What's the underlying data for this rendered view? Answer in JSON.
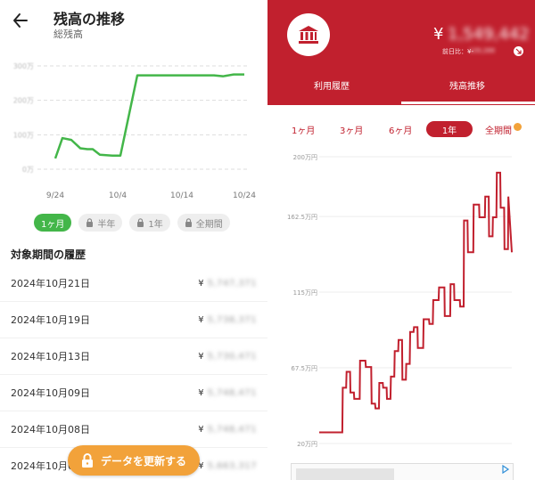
{
  "left": {
    "title": "残高の推移",
    "subtitle": "総残高",
    "chart": {
      "type": "line",
      "y_tick_labels": [
        "300万",
        "200万",
        "100万",
        "0万"
      ],
      "x_tick_labels": [
        "9/24",
        "10/4",
        "10/14",
        "10/24"
      ],
      "line_color": "#43b649",
      "series_dates": [
        "9/22",
        "9/24",
        "9/26",
        "9/28",
        "9/30",
        "10/1",
        "10/2",
        "10/4",
        "10/5",
        "10/6",
        "10/8",
        "10/10",
        "10/14",
        "10/18",
        "10/22",
        "10/24"
      ],
      "values": [
        1.0,
        2.1,
        2.0,
        1.55,
        1.5,
        1.5,
        1.2,
        1.15,
        1.15,
        5.5,
        5.5,
        5.5,
        5.5,
        5.45,
        5.55,
        5.55
      ],
      "value_unit": "relative (y-axis labels obscured)"
    },
    "periods": [
      {
        "label": "1ヶ月",
        "active": true,
        "locked": false
      },
      {
        "label": "半年",
        "active": false,
        "locked": true
      },
      {
        "label": "1年",
        "active": false,
        "locked": true
      },
      {
        "label": "全期間",
        "active": false,
        "locked": true
      }
    ],
    "history_title": "対象期間の履歴",
    "history": [
      {
        "date": "2024年10月21日",
        "currency": "¥",
        "amount": "5,747,371"
      },
      {
        "date": "2024年10月19日",
        "currency": "¥",
        "amount": "5,738,371"
      },
      {
        "date": "2024年10月13日",
        "currency": "¥",
        "amount": "5,730,471"
      },
      {
        "date": "2024年10月09日",
        "currency": "¥",
        "amount": "5,748,471"
      },
      {
        "date": "2024年10月08日",
        "currency": "¥",
        "amount": "5,748,471"
      },
      {
        "date": "2024年10月0",
        "currency": "¥",
        "amount": "5,663,317"
      }
    ],
    "fab_label": "データを更新する"
  },
  "right": {
    "balance_currency": "¥",
    "balance_amount": "1,549,442",
    "prev_day_label": "前日比：¥-",
    "prev_day_amount": "109,288",
    "tabs": [
      {
        "label": "利用履歴",
        "active": false
      },
      {
        "label": "残高推移",
        "active": true
      }
    ],
    "periods": [
      {
        "label": "1ヶ月",
        "active": false
      },
      {
        "label": "3ヶ月",
        "active": false
      },
      {
        "label": "6ヶ月",
        "active": false
      },
      {
        "label": "1年",
        "active": true
      },
      {
        "label": "全期間",
        "active": false,
        "premium": true
      }
    ],
    "colors": {
      "brand": "#c1202e",
      "accent": "#f2a23a",
      "green": "#43b649"
    }
  },
  "chart_data": {
    "type": "line",
    "title": "",
    "ylabel": "",
    "xlabel": "",
    "ylim": [
      20,
      200
    ],
    "y_ticks": [
      20,
      67.5,
      115,
      162.5,
      200
    ],
    "y_tick_labels": [
      "20万円",
      "67.5万円",
      "115万円",
      "162.5万円",
      "200万円"
    ],
    "grid": true,
    "legend": "none",
    "series": [
      {
        "line_color": "#c1202e",
        "x": [
          0,
          0.25,
          0.5,
          0.75,
          1,
          1.2,
          1.22,
          1.4,
          1.42,
          1.6,
          1.62,
          1.8,
          1.82,
          2.1,
          2.12,
          2.4,
          2.42,
          2.7,
          2.72,
          2.9,
          2.92,
          3.1,
          3.12,
          3.3,
          3.32,
          3.5,
          3.52,
          3.7,
          3.72,
          3.9,
          3.92,
          4.1,
          4.12,
          4.3,
          4.32,
          4.5,
          4.52,
          4.7,
          4.72,
          4.9,
          4.92,
          5.1,
          5.12,
          5.4,
          5.42,
          5.7,
          5.72,
          5.9,
          5.92,
          6.2,
          6.22,
          6.5,
          6.52,
          6.8,
          6.82,
          7.0,
          7.02,
          7.3,
          7.32,
          7.5,
          7.52,
          7.7,
          7.72,
          8.0,
          8.02,
          8.3,
          8.32,
          8.6,
          8.62,
          8.8,
          8.82,
          9.0,
          9.02,
          9.2,
          9.22,
          9.4,
          9.42,
          9.6,
          9.62,
          9.8,
          9.82,
          10.0
        ],
        "y": [
          27,
          27,
          27,
          27,
          27,
          27,
          55,
          55,
          65,
          65,
          52,
          52,
          48,
          48,
          72,
          72,
          68,
          68,
          45,
          45,
          42,
          42,
          58,
          58,
          55,
          55,
          48,
          48,
          62,
          62,
          78,
          78,
          85,
          85,
          60,
          60,
          70,
          70,
          90,
          90,
          93,
          93,
          80,
          80,
          98,
          98,
          95,
          95,
          110,
          110,
          118,
          118,
          100,
          100,
          120,
          120,
          110,
          110,
          106,
          106,
          160,
          160,
          140,
          140,
          170,
          170,
          162,
          162,
          175,
          175,
          150,
          150,
          162,
          162,
          190,
          190,
          168,
          168,
          142,
          142,
          175,
          140
        ]
      }
    ]
  }
}
